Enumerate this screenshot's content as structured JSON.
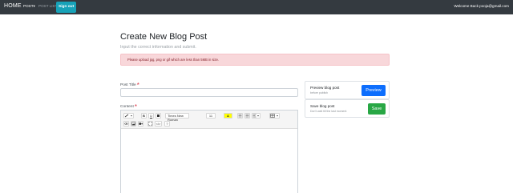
{
  "navbar": {
    "brand": "HOME",
    "post_menu": "POST▾",
    "post_list": "POST LIST",
    "signout_label": "Sign out",
    "welcome_text": "Welcome Back  pooja@gmail.com"
  },
  "page": {
    "title": "Create New Blog Post",
    "subtitle": "Input the correct information and submit.",
    "alert_text": "Please upload jpg, png or gif which are less than 5MB in size."
  },
  "form": {
    "post_title_label": "Post Title",
    "content_label": "Content",
    "required_mark": "*",
    "post_title_value": ""
  },
  "editor_toolbar": {
    "font_family": "Times New Roman",
    "font_size": "11",
    "text_color_label": "A",
    "bold": "B",
    "underline": "U",
    "help": "?",
    "code": "</>"
  },
  "sidebar": {
    "preview": {
      "title": "Preview blog post",
      "subtitle": "before publish",
      "button": "Preview"
    },
    "save": {
      "title": "Save blog post",
      "subtitle": "Don't wait till the last moment",
      "button": "Save"
    }
  },
  "colors": {
    "navbar_bg": "#343a40",
    "signout_bg": "#17a2b8",
    "alert_bg": "#f8d7da",
    "alert_text": "#842029",
    "required": "#dc3545",
    "preview_btn": "#0d6efd",
    "save_btn": "#28a745"
  }
}
